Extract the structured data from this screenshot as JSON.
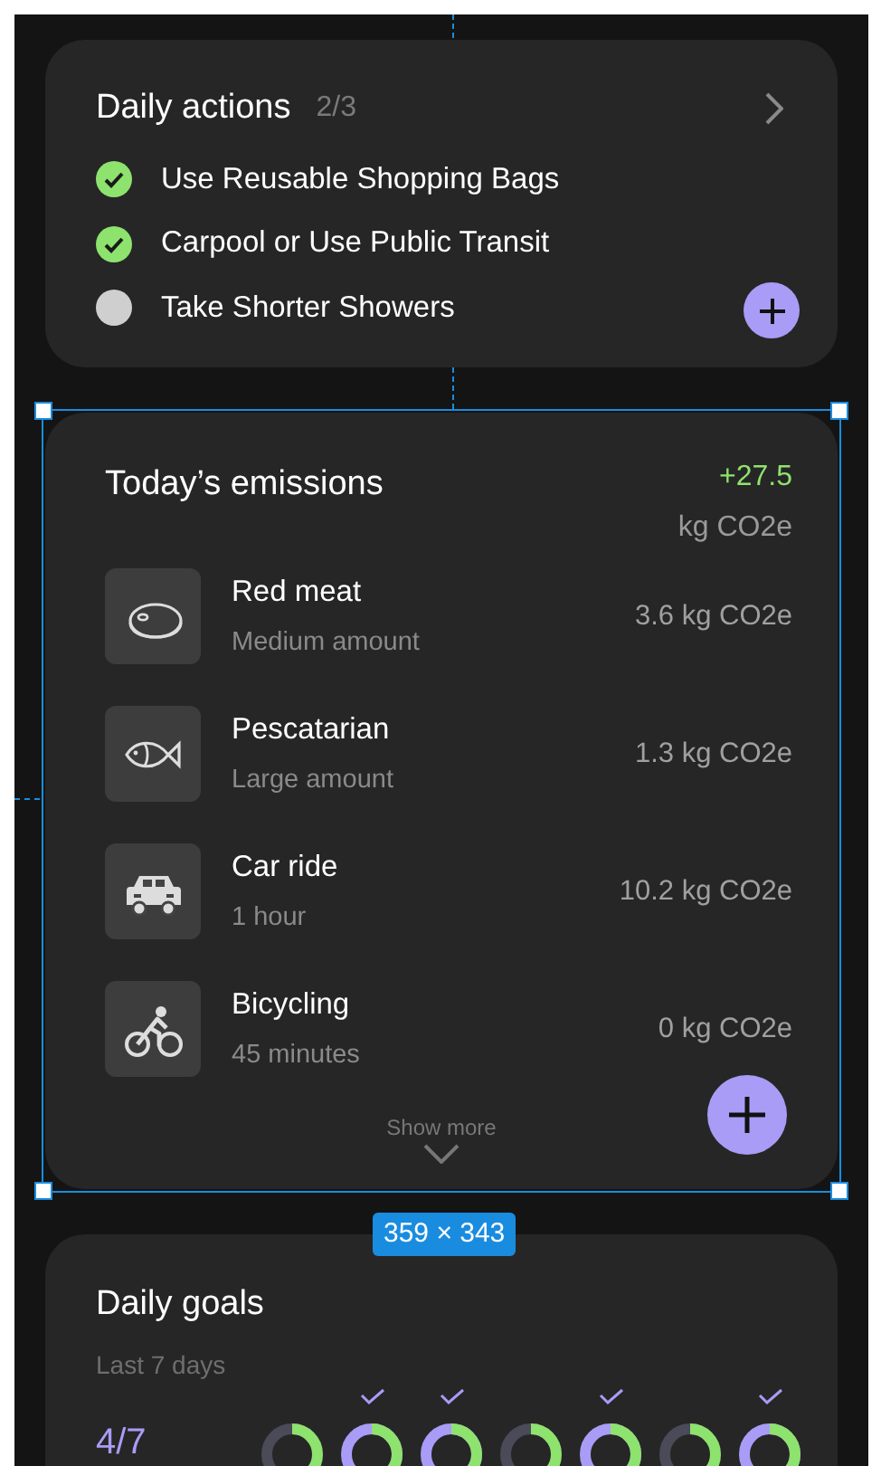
{
  "daily_actions": {
    "title": "Daily actions",
    "count": "2/3",
    "items": [
      {
        "label": "Use Reusable Shopping Bags",
        "checked": true
      },
      {
        "label": "Carpool or Use Public Transit",
        "checked": true
      },
      {
        "label": "Take Shorter Showers",
        "checked": false
      }
    ]
  },
  "emissions": {
    "title": "Today’s emissions",
    "total": "+27.5",
    "unit": "kg CO2e",
    "items": [
      {
        "kind": "meat",
        "name": "Red meat",
        "detail": "Medium amount",
        "amount": "3.6 kg CO2e"
      },
      {
        "kind": "fish",
        "name": "Pescatarian",
        "detail": "Large amount",
        "amount": "1.3 kg CO2e"
      },
      {
        "kind": "car",
        "name": "Car ride",
        "detail": "1 hour",
        "amount": "10.2 kg CO2e"
      },
      {
        "kind": "bike",
        "name": "Bicycling",
        "detail": "45 minutes",
        "amount": "0 kg CO2e"
      }
    ],
    "show_more": "Show more"
  },
  "selection": {
    "size": "359 × 343"
  },
  "daily_goals": {
    "title": "Daily goals",
    "subtitle": "Last 7 days",
    "score": "4/7",
    "days": [
      {
        "done": false
      },
      {
        "done": true
      },
      {
        "done": true
      },
      {
        "done": false
      },
      {
        "done": true
      },
      {
        "done": false
      },
      {
        "done": true
      }
    ]
  }
}
